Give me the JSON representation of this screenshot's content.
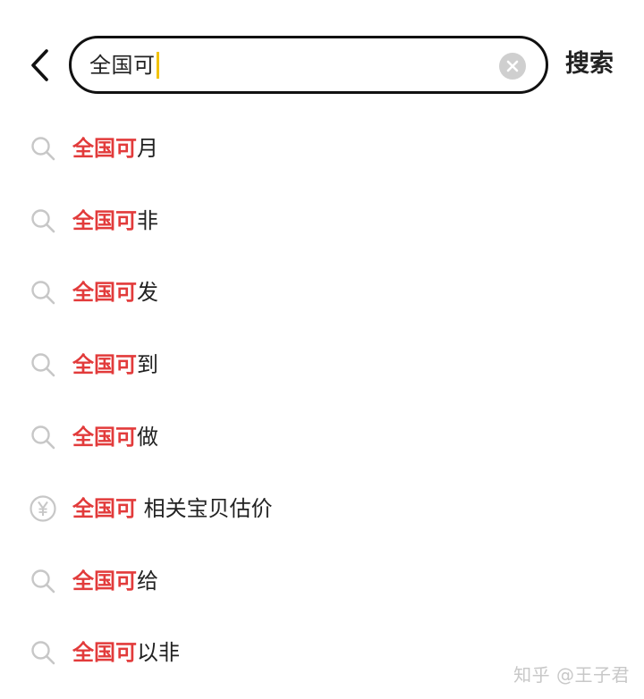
{
  "search": {
    "query": "全国可",
    "submit_label": "搜索"
  },
  "suggestions": [
    {
      "highlight": "全国可",
      "rest": "月",
      "icon": "search-icon"
    },
    {
      "highlight": "全国可",
      "rest": "非",
      "icon": "search-icon"
    },
    {
      "highlight": "全国可",
      "rest": "发",
      "icon": "search-icon"
    },
    {
      "highlight": "全国可",
      "rest": "到",
      "icon": "search-icon"
    },
    {
      "highlight": "全国可",
      "rest": "做",
      "icon": "search-icon"
    },
    {
      "highlight": "全国可",
      "rest": " 相关宝贝估价",
      "icon": "yuan-price-icon"
    },
    {
      "highlight": "全国可",
      "rest": "给",
      "icon": "search-icon"
    },
    {
      "highlight": "全国可",
      "rest": "以非",
      "icon": "search-icon"
    }
  ],
  "watermark": "知乎 @王子君",
  "colors": {
    "highlight": "#e23b3b",
    "caret": "#f2c200",
    "border": "#111111",
    "icon": "#c7c7c7"
  }
}
